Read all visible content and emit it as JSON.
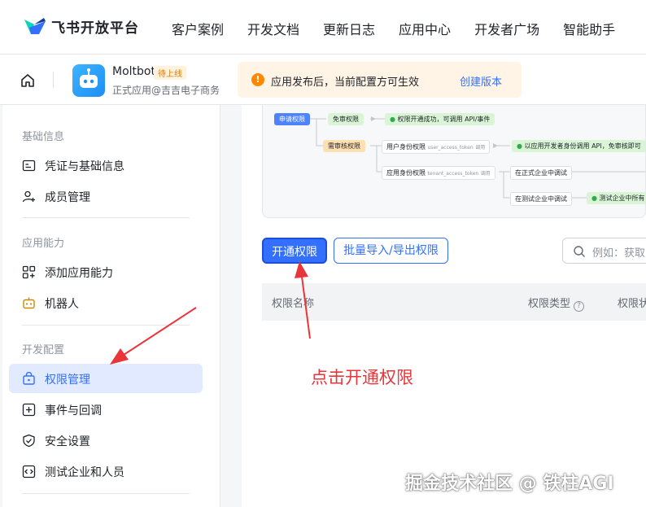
{
  "brand": "飞书开放平台",
  "nav": [
    "客户案例",
    "开发文档",
    "更新日志",
    "应用中心",
    "开发者广场",
    "智能助手"
  ],
  "app": {
    "name": "Moltbot",
    "badge": "待上线",
    "subtitle": "正式应用@吉吉电子商务"
  },
  "notice": {
    "text": "应用发布后，当前配置方可生效",
    "link": "创建版本"
  },
  "sidebar": {
    "sections": [
      {
        "title": "基础信息",
        "items": [
          {
            "label": "凭证与基础信息",
            "icon": "credential-icon"
          },
          {
            "label": "成员管理",
            "icon": "member-icon"
          }
        ]
      },
      {
        "title": "应用能力",
        "items": [
          {
            "label": "添加应用能力",
            "icon": "add-capability-icon"
          },
          {
            "label": "机器人",
            "icon": "robot-icon"
          }
        ]
      },
      {
        "title": "开发配置",
        "items": [
          {
            "label": "权限管理",
            "icon": "permission-icon",
            "active": true
          },
          {
            "label": "事件与回调",
            "icon": "event-icon"
          },
          {
            "label": "安全设置",
            "icon": "shield-icon"
          },
          {
            "label": "测试企业和人员",
            "icon": "code-icon"
          }
        ]
      }
    ]
  },
  "flow": {
    "apply": "申请权限",
    "free": "免审权限",
    "ok": "权限开通成功，可调用 API/事件",
    "need": "需审核权限",
    "user_perm": "用户身份权限",
    "user_token": "user_access_token",
    "call": "调用",
    "user_result_a": "以应用开发者身份",
    "user_result_b": "调用 API，免审核即可",
    "app_perm": "应用身份权限",
    "app_token": "tenant_access_token",
    "formal": "在正式企业中调试",
    "test": "在测试企业中调试",
    "test_result_a": "测试企业",
    "test_result_b": "中所有"
  },
  "actions": {
    "enable": "开通权限",
    "batch": "批量导入/导出权限",
    "search_placeholder": "例如：获取"
  },
  "table": {
    "headers": [
      "权限名称",
      "权限类型",
      "权限状"
    ]
  },
  "annotation": "点击开通权限",
  "watermark": "掘金技术社区 @ 铁柱AGI",
  "colors": {
    "primary": "#3370ff",
    "annotation": "#e8363a",
    "warning": "#ff8800"
  }
}
